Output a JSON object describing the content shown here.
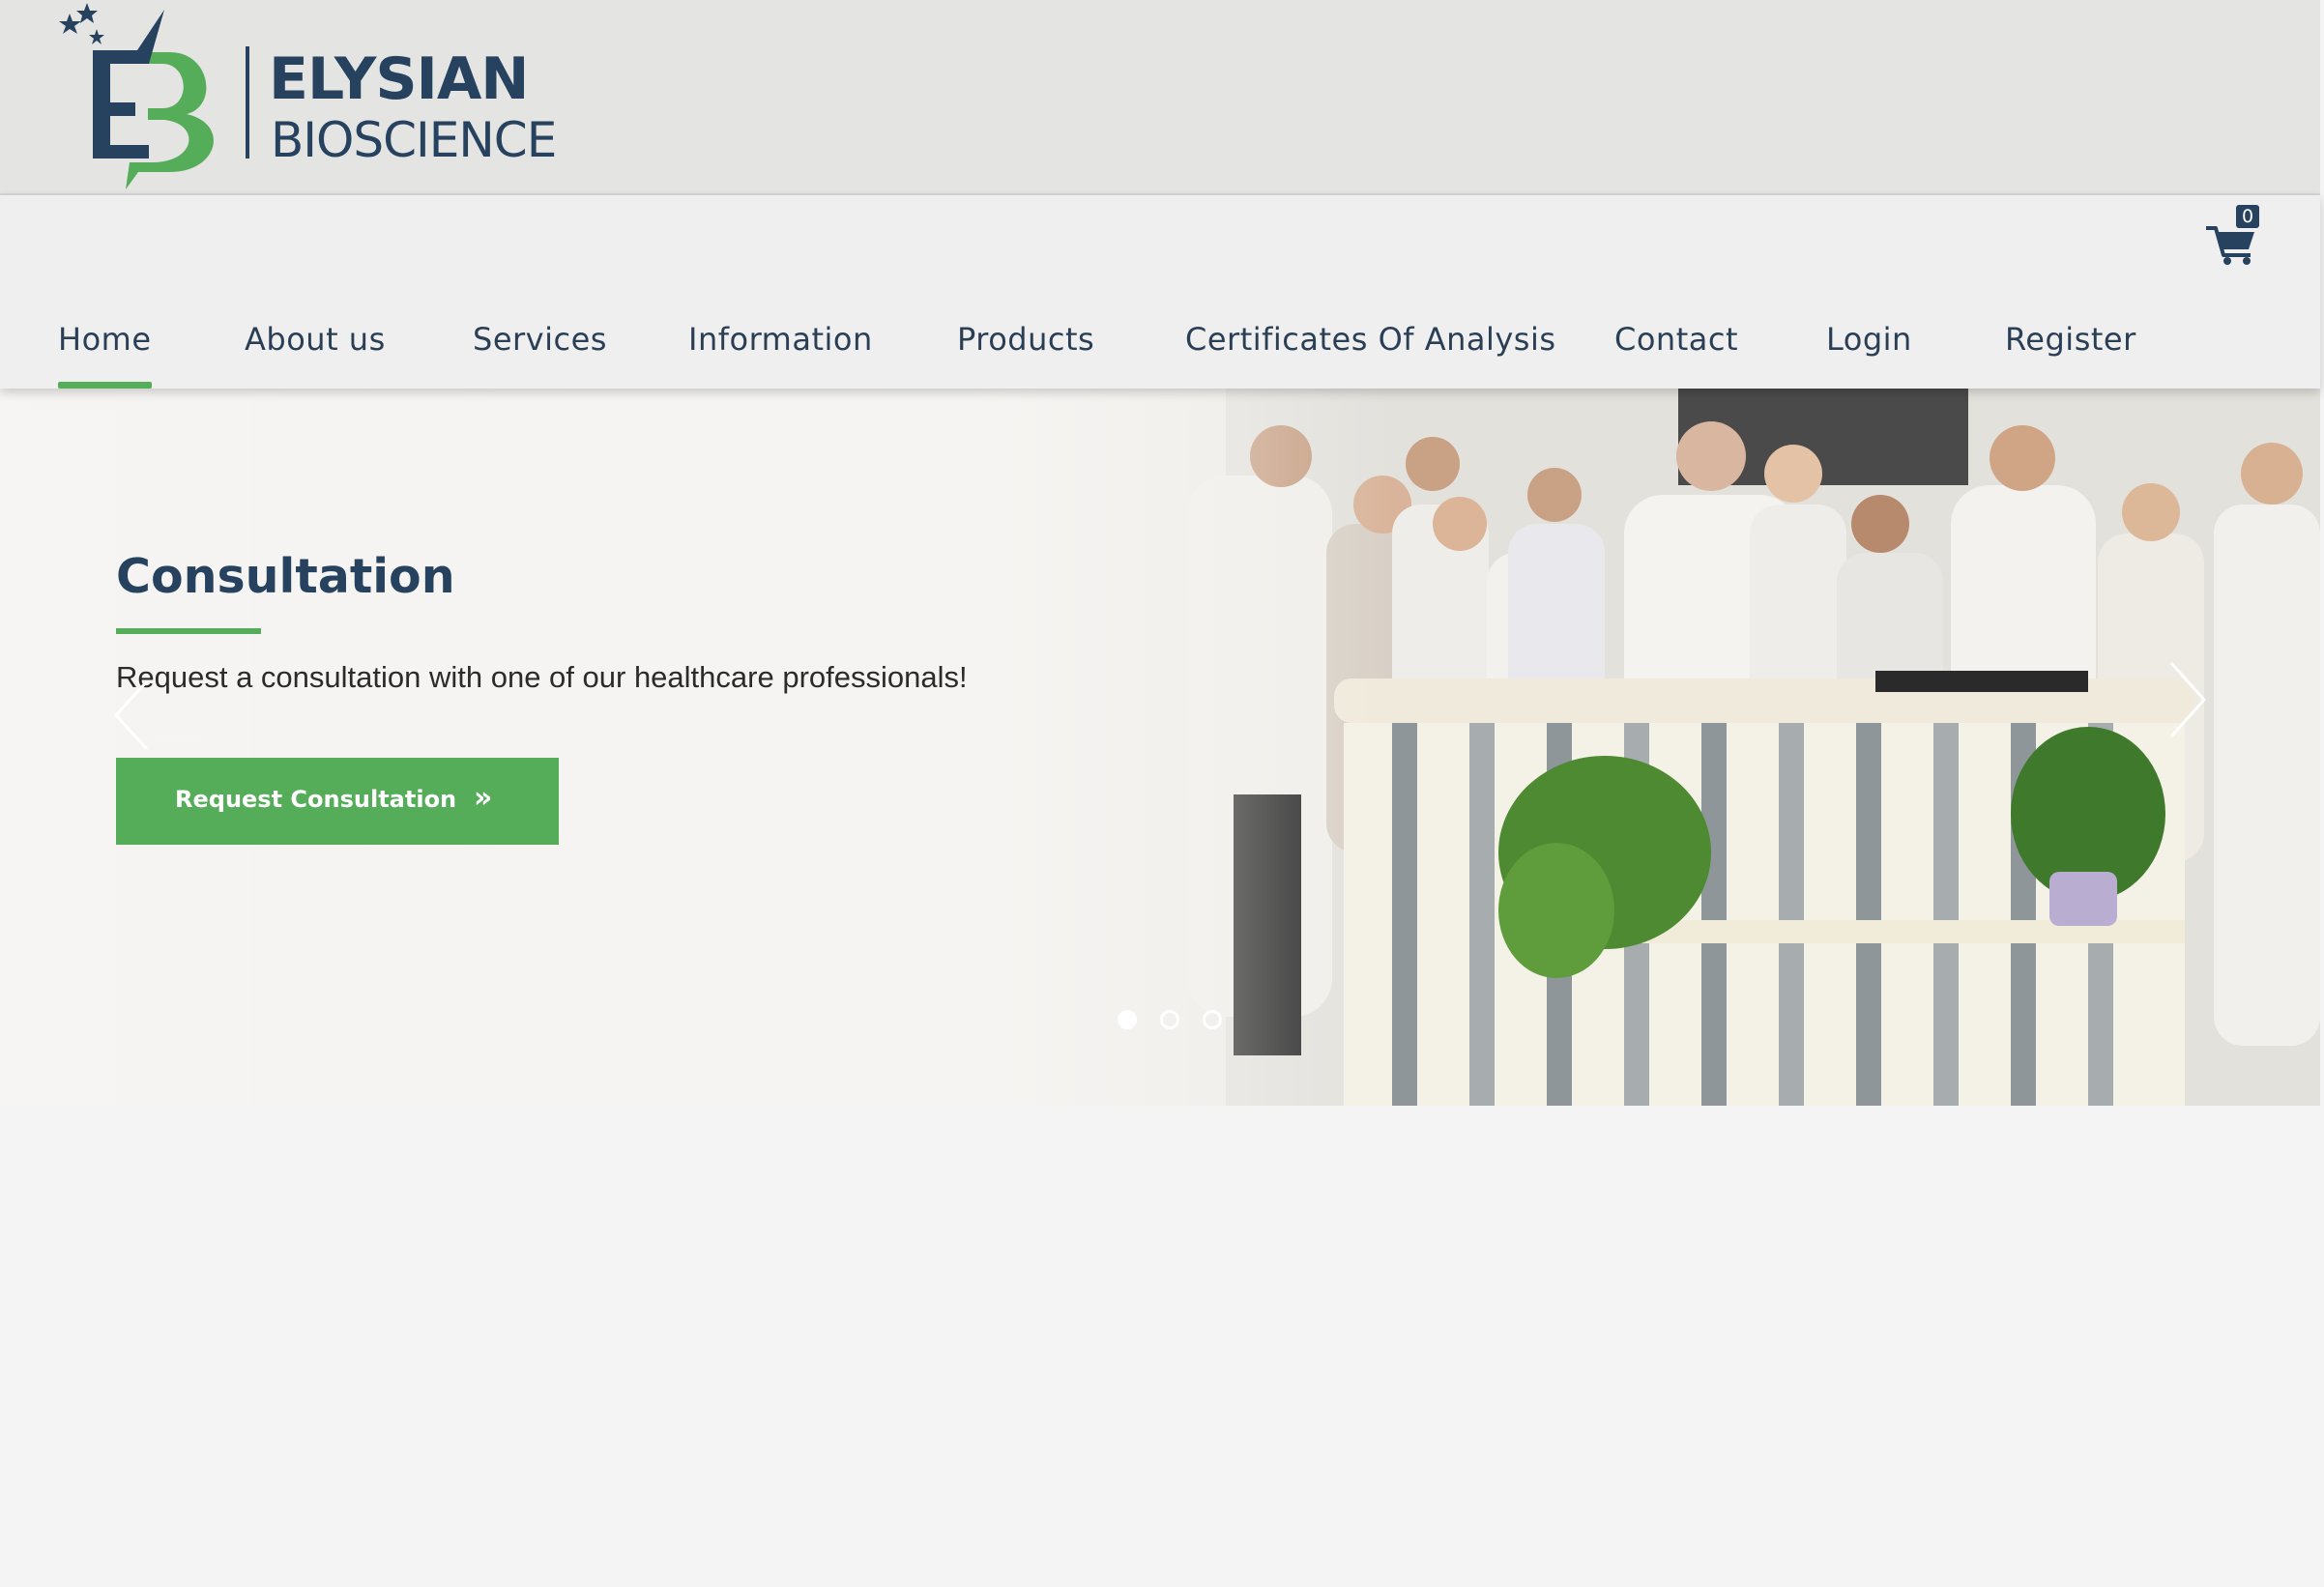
{
  "brand": {
    "name_line1": "ELYSIAN",
    "name_line2": "BIOSCIENCE",
    "monogram": "EB",
    "colors": {
      "navy": "#26425f",
      "green": "#55ad5a"
    }
  },
  "cart": {
    "icon": "shopping-cart-icon",
    "count": "0"
  },
  "nav": {
    "items": [
      {
        "label": "Home",
        "active": true
      },
      {
        "label": "About us"
      },
      {
        "label": "Services"
      },
      {
        "label": "Information"
      },
      {
        "label": "Products"
      },
      {
        "label": "Certificates Of Analysis"
      },
      {
        "label": "Contact"
      },
      {
        "label": "Login"
      },
      {
        "label": "Register"
      }
    ]
  },
  "hero": {
    "title": "Consultation",
    "subtitle": "Request a consultation with one of our healthcare professionals!",
    "cta_label": "Request Consultation",
    "cta_icon": "double-chevron-right-icon",
    "prev_icon": "chevron-left-icon",
    "next_icon": "chevron-right-icon",
    "slides": {
      "total": 3,
      "current": 1
    }
  }
}
